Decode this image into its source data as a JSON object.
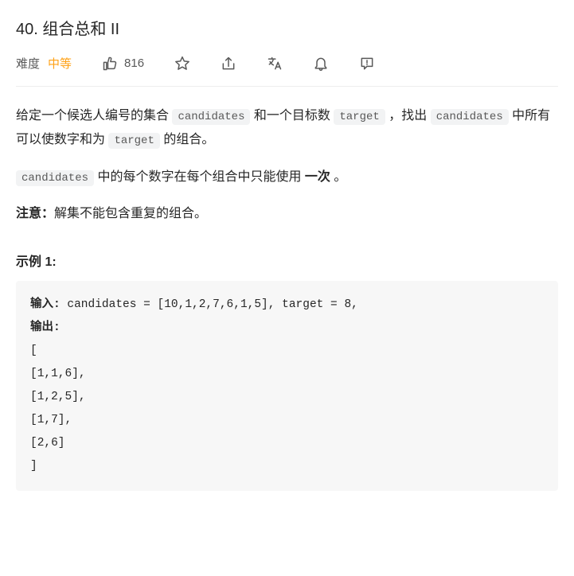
{
  "title": "40. 组合总和 II",
  "meta": {
    "difficulty_label": "难度",
    "difficulty_value": "中等",
    "likes": "816"
  },
  "description": {
    "p1_a": "给定一个候选人编号的集合 ",
    "p1_code1": "candidates",
    "p1_b": " 和一个目标数 ",
    "p1_code2": "target",
    "p1_c": " ，找出 ",
    "p1_code3": "candidates",
    "p1_d": " 中所有可以使数字和为 ",
    "p1_code4": "target",
    "p1_e": " 的组合。",
    "p2_code": "candidates",
    "p2_a": " 中的每个数字在每个组合中只能使用 ",
    "p2_strong": "一次",
    "p2_b": " 。",
    "p3_strong": "注意：",
    "p3_a": "解集不能包含重复的组合。 "
  },
  "example": {
    "title": "示例 1:",
    "input_label": "输入: ",
    "input_value": "candidates = [10,1,2,7,6,1,5], target = 8,",
    "output_label": "输出:",
    "output_value": "[\n[1,1,6],\n[1,2,5],\n[1,7],\n[2,6]\n]"
  }
}
